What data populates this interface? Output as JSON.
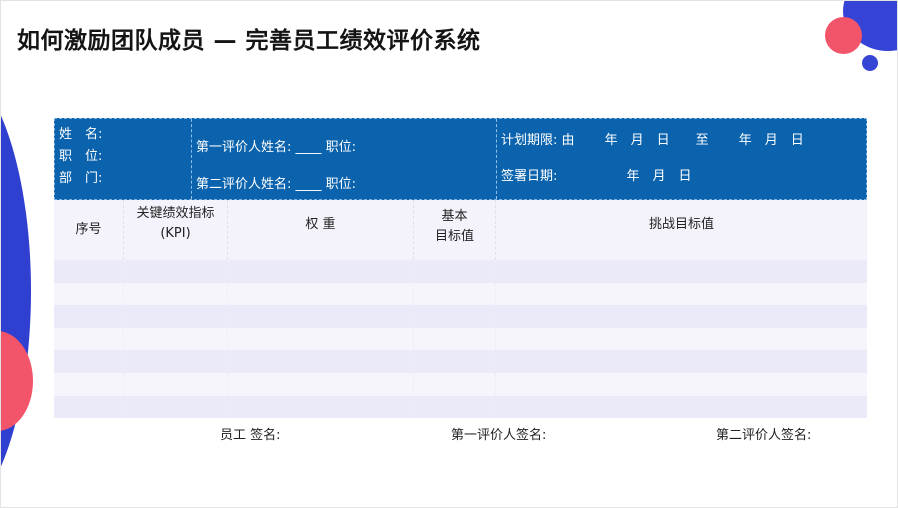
{
  "title": "如何激励团队成员 — 完善员工绩效评价系统",
  "header": {
    "col1": [
      "姓　名:",
      "职　位:",
      "部　门:"
    ],
    "col2": [
      "第一评价人姓名: ____ 职位:",
      "第二评价人姓名: ____ 职位:"
    ],
    "col3": [
      "计划期限: 由　　 年　月　日　　至　　 年　月　日",
      "签署日期:　　　　　 年　月　日"
    ]
  },
  "columns": [
    "序号",
    "关键绩效指标\n(KPI)",
    "权  重",
    "基本\n目标值",
    "挑战目标值"
  ],
  "row_count": 7,
  "signatures": [
    "员工 签名:",
    "第一评价人签名:",
    "第二评价人签名:"
  ],
  "colors": {
    "header_bg": "#0b63ad",
    "row_a": "#ebeaf8",
    "row_b": "#f6f5fc",
    "accent_red": "#f2546a",
    "accent_blue": "#2f3fd0"
  }
}
